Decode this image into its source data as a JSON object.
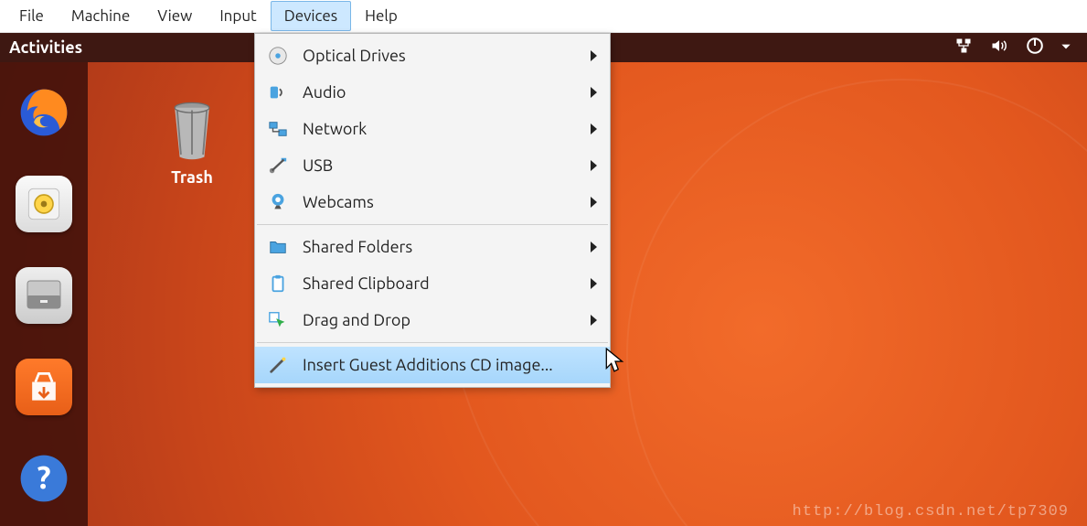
{
  "host_menu": {
    "items": [
      {
        "label": "File"
      },
      {
        "label": "Machine"
      },
      {
        "label": "View"
      },
      {
        "label": "Input"
      },
      {
        "label": "Devices",
        "active": true
      },
      {
        "label": "Help"
      }
    ]
  },
  "topbar": {
    "activities": "Activities",
    "tray": {
      "network_icon": "network-wired-icon",
      "volume_icon": "volume-high-icon",
      "power_icon": "power-icon",
      "dropdown_icon": "chevron-down-icon"
    }
  },
  "launcher": {
    "apps": [
      {
        "name": "firefox-icon"
      },
      {
        "name": "rhythmbox-icon"
      },
      {
        "name": "files-icon"
      },
      {
        "name": "software-icon"
      },
      {
        "name": "help-icon"
      }
    ]
  },
  "desktop": {
    "trash": {
      "label": "Trash",
      "icon": "trash-icon"
    }
  },
  "devices_menu": {
    "groups": [
      [
        {
          "icon": "disc-icon",
          "label": "Optical Drives",
          "submenu": true
        },
        {
          "icon": "audio-icon",
          "label": "Audio",
          "submenu": true
        },
        {
          "icon": "network-icon",
          "label": "Network",
          "submenu": true
        },
        {
          "icon": "usb-icon",
          "label": "USB",
          "submenu": true
        },
        {
          "icon": "webcam-icon",
          "label": "Webcams",
          "submenu": true
        }
      ],
      [
        {
          "icon": "folder-icon",
          "label": "Shared Folders",
          "submenu": true
        },
        {
          "icon": "clipboard-icon",
          "label": "Shared Clipboard",
          "submenu": true
        },
        {
          "icon": "dragdrop-icon",
          "label": "Drag and Drop",
          "submenu": true
        }
      ],
      [
        {
          "icon": "wand-icon",
          "label": "Insert Guest Additions CD image...",
          "submenu": false,
          "highlight": true
        }
      ]
    ]
  },
  "watermark": "http://blog.csdn.net/tp7309"
}
